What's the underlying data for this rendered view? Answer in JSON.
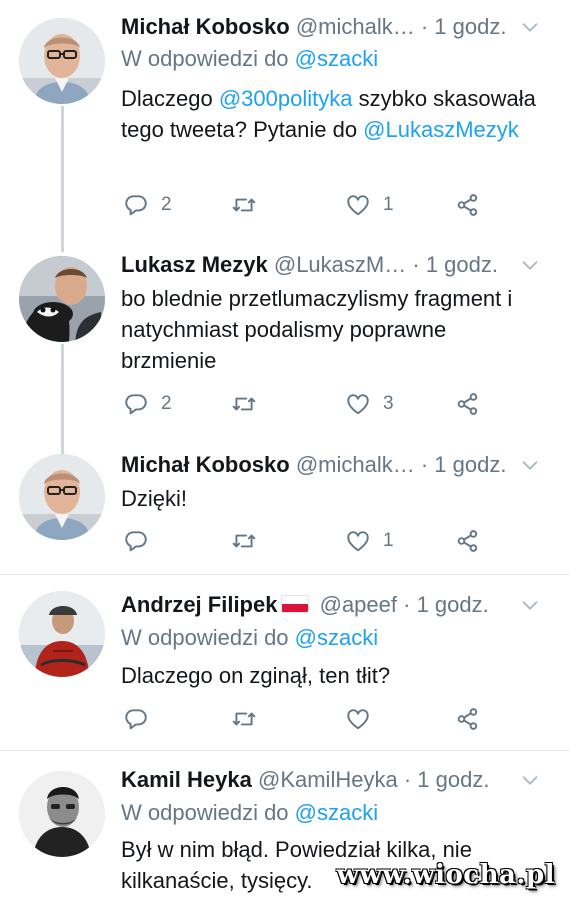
{
  "colors": {
    "link": "#1da1f2",
    "muted": "#657786",
    "text": "#14171a",
    "divider": "#e1e8ed"
  },
  "tweets": [
    {
      "name": "Michał Kobosko",
      "handle": "@michalk…",
      "separator": "·",
      "time": "1 godz.",
      "reply_prefix": "W odpowiedzi do",
      "reply_to": "@szacki",
      "text_parts": [
        "Dlaczego ",
        "@300polityka",
        " szybko skasowała tego tweeta? Pytanie do ",
        "@LukaszMezyk"
      ],
      "replies": "2",
      "retweets": "",
      "likes": "1",
      "icons": {
        "reply": "reply-icon",
        "retweet": "retweet-icon",
        "like": "heart-icon",
        "share": "share-icon"
      }
    },
    {
      "name": "Lukasz Mezyk",
      "handle": "@LukaszM…",
      "separator": "·",
      "time": "1 godz.",
      "text": "bo blednie przetlumaczylismy fragment i natychmiast podalismy poprawne brzmienie",
      "replies": "2",
      "retweets": "",
      "likes": "3"
    },
    {
      "name": "Michał Kobosko",
      "handle": "@michalk…",
      "separator": "·",
      "time": "1 godz.",
      "text": "Dzięki!",
      "replies": "",
      "retweets": "",
      "likes": "1"
    },
    {
      "name": "Andrzej Filipek",
      "flag": "poland-flag-icon",
      "handle": "@apeef",
      "separator": "·",
      "time": "1 godz.",
      "reply_prefix": "W odpowiedzi do",
      "reply_to": "@szacki",
      "text": "Dlaczego on zginął, ten tłit?",
      "replies": "",
      "retweets": "",
      "likes": ""
    },
    {
      "name": "Kamil Heyka",
      "handle": "@KamilHeyka",
      "separator": "·",
      "time": "1 godz.",
      "reply_prefix": "W odpowiedzi do",
      "reply_to": "@szacki",
      "text": "Był w nim błąd. Powiedział kilka, nie kilkanaście, tysięcy."
    }
  ],
  "watermark": "www.wiocha.pl"
}
